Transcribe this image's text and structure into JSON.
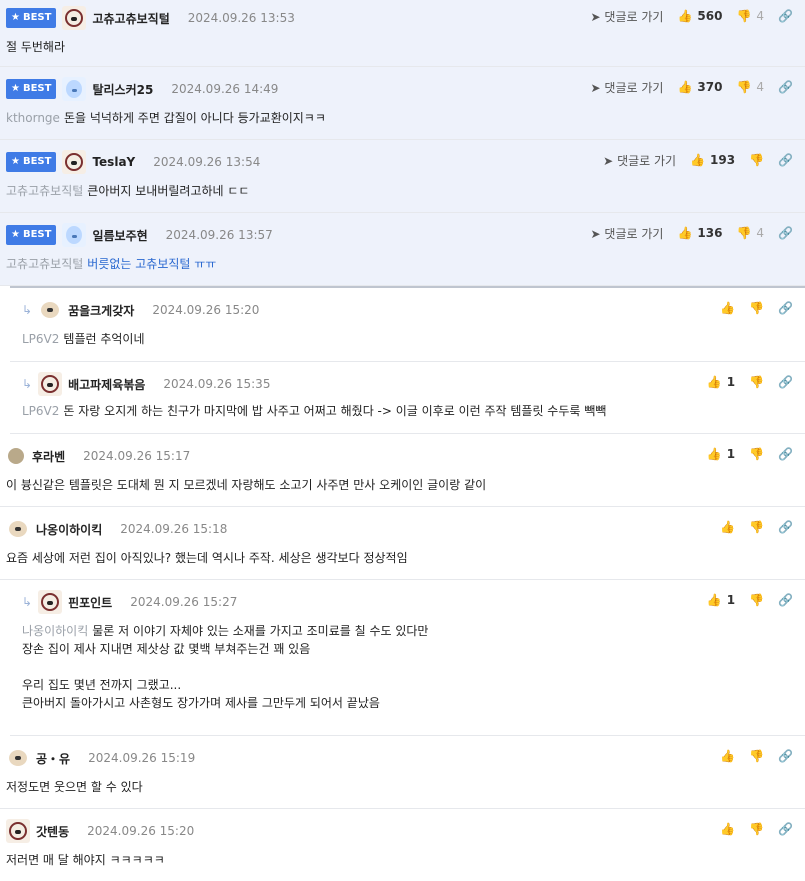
{
  "labels": {
    "best": "BEST",
    "goto": "댓글로 가기"
  },
  "comments": [
    {
      "nick": "고츄고츄보직털",
      "date": "2024.09.26 13:53",
      "likes": "560",
      "dislikes": "4",
      "text": "절 두번해라"
    },
    {
      "nick": "탈리스커25",
      "date": "2024.09.26 14:49",
      "likes": "370",
      "dislikes": "4",
      "mention": "kthornge",
      "text": "돈을 넉넉하게 주면 갑질이 아니다 등가교환이지ㅋㅋ"
    },
    {
      "nick": "TeslaY",
      "date": "2024.09.26 13:54",
      "likes": "193",
      "dislikes": "",
      "mention": "고츄고츄보직털",
      "text": "큰아버지 보내버릴려고하네 ㄷㄷ"
    },
    {
      "nick": "일름보주현",
      "date": "2024.09.26 13:57",
      "likes": "136",
      "dislikes": "4",
      "mention": "고츄고츄보직털",
      "text": "버릇없는 고츄보직털 ㅠㅠ"
    },
    {
      "nick": "꿈을크게갖자",
      "date": "2024.09.26 15:20",
      "likes": "",
      "dislikes": "",
      "mention": "LP6V2",
      "text": "템플런 추억이네"
    },
    {
      "nick": "배고파제육볶음",
      "date": "2024.09.26 15:35",
      "likes": "1",
      "dislikes": "",
      "mention": "LP6V2",
      "text": "돈 자랑 오지게 하는 친구가 마지막에 밥 사주고 어쩌고 해줬다 -> 이글 이후로 이런 주작 템플릿 수두룩 빽빽"
    },
    {
      "nick": "후라벤",
      "date": "2024.09.26 15:17",
      "likes": "1",
      "dislikes": "",
      "text": "이 븅신같은 템플릿은 도대체 뭔 지 모르겠네 자랑해도 소고기 사주면 만사 오케이인 글이랑 같이"
    },
    {
      "nick": "나옹이하이킥",
      "date": "2024.09.26 15:18",
      "likes": "",
      "dislikes": "",
      "text": "요즘 세상에 저런 집이 아직있나? 했는데 역시나 주작. 세상은 생각보다 정상적임"
    },
    {
      "nick": "핀포인트",
      "date": "2024.09.26 15:27",
      "likes": "1",
      "dislikes": "",
      "mention": "나옹이하이킥",
      "text": "물론 저 이야기 자체야 있는 소재를 가지고 조미료를 칠 수도 있다만\n장손 집이 제사 지내면 제삿상 값 몇백 부쳐주는건 꽤 있음\n\n우리 집도 몇년 전까지 그랬고...\n큰아버지 돌아가시고 사촌형도 장가가며 제사를 그만두게 되어서 끝났음"
    },
    {
      "nick": "공・유",
      "date": "2024.09.26 15:19",
      "likes": "",
      "dislikes": "",
      "text": "저정도면 웃으면 할 수 있다"
    },
    {
      "nick": "갓텐동",
      "date": "2024.09.26 15:20",
      "likes": "",
      "dislikes": "",
      "text": "저러면 매 달 해야지 ㅋㅋㅋㅋㅋ"
    }
  ]
}
